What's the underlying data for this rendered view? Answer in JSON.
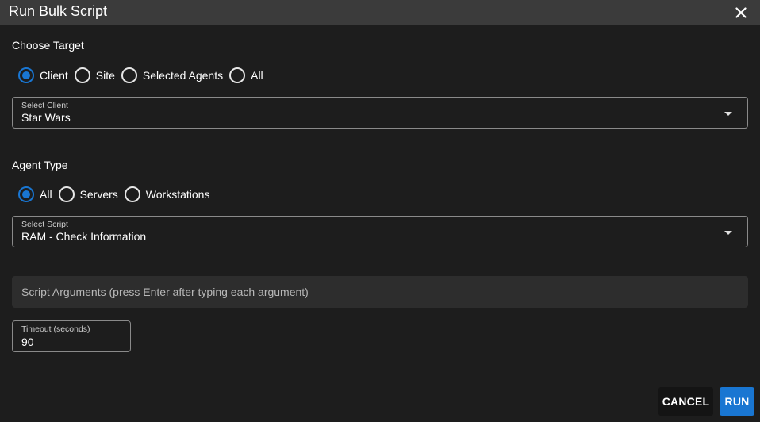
{
  "dialog": {
    "title": "Run Bulk Script"
  },
  "target": {
    "heading": "Choose Target",
    "options": [
      {
        "label": "Client",
        "checked": true
      },
      {
        "label": "Site",
        "checked": false
      },
      {
        "label": "Selected Agents",
        "checked": false
      },
      {
        "label": "All",
        "checked": false
      }
    ]
  },
  "client_select": {
    "label": "Select Client",
    "value": "Star Wars"
  },
  "agent_type": {
    "heading": "Agent Type",
    "options": [
      {
        "label": "All",
        "checked": true
      },
      {
        "label": "Servers",
        "checked": false
      },
      {
        "label": "Workstations",
        "checked": false
      }
    ]
  },
  "script_select": {
    "label": "Select Script",
    "value": "RAM - Check Information"
  },
  "script_args": {
    "placeholder": "Script Arguments (press Enter after typing each argument)"
  },
  "timeout": {
    "label": "Timeout (seconds)",
    "value": "90"
  },
  "actions": {
    "cancel_label": "CANCEL",
    "run_label": "RUN"
  },
  "colors": {
    "accent": "#1976d2",
    "titlebar": "#3b3b3b",
    "background": "#1d1d1d"
  }
}
